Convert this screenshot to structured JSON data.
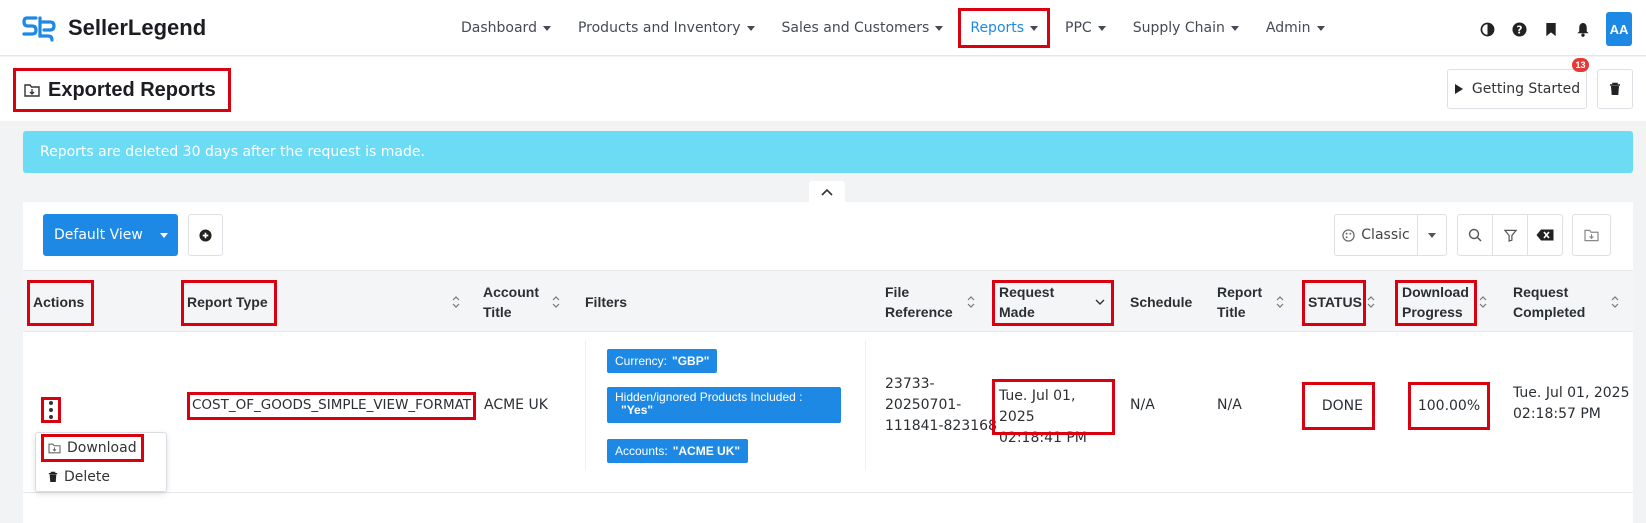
{
  "brand": {
    "name": "SellerLegend",
    "accent": "#1e88e5"
  },
  "nav": {
    "items": [
      {
        "label": "Dashboard"
      },
      {
        "label": "Products and Inventory"
      },
      {
        "label": "Sales and Customers"
      },
      {
        "label": "Reports"
      },
      {
        "label": "PPC"
      },
      {
        "label": "Supply Chain"
      },
      {
        "label": "Admin"
      }
    ],
    "icons": [
      "contrast-icon",
      "help-icon",
      "bookmark-icon",
      "bell-icon"
    ],
    "avatar": "AA"
  },
  "header": {
    "title": "Exported Reports",
    "getting_started_label": "Getting Started",
    "notification_count": "13"
  },
  "notice": {
    "text": "Reports are deleted 30 days after the request is made.",
    "color": "#6cdcf5"
  },
  "toolbar": {
    "view_label": "Default View",
    "layout_label": "Classic"
  },
  "table": {
    "columns": [
      {
        "key": "actions",
        "label": "Actions"
      },
      {
        "key": "report_type",
        "label": "Report Type"
      },
      {
        "key": "account_title",
        "label": "Account Title"
      },
      {
        "key": "filters",
        "label": "Filters"
      },
      {
        "key": "file_reference",
        "label": "File Reference"
      },
      {
        "key": "request_made",
        "label": "Request Made"
      },
      {
        "key": "schedule",
        "label": "Schedule"
      },
      {
        "key": "report_title",
        "label": "Report Title"
      },
      {
        "key": "status",
        "label": "STATUS"
      },
      {
        "key": "download_progress",
        "label": "Download Progress"
      },
      {
        "key": "request_completed",
        "label": "Request Completed"
      }
    ],
    "rows": [
      {
        "report_type": "COST_OF_GOODS_SIMPLE_VIEW_FORMAT",
        "account_title": "ACME UK",
        "filters": [
          {
            "name": "Currency:",
            "value": "\"GBP\""
          },
          {
            "name": "Hidden/ignored Products Included :",
            "value": "\"Yes\""
          },
          {
            "name": "Accounts:",
            "value": "\"ACME UK\""
          }
        ],
        "file_reference": "23733-20250701-111841-823168",
        "file_reference_lines": [
          "23733-",
          "20250701-",
          "111841-823168"
        ],
        "request_made": [
          "Tue. Jul 01, 2025",
          "02:18:41 PM"
        ],
        "schedule": "N/A",
        "report_title": "N/A",
        "status": "DONE",
        "download_progress": "100.00%",
        "request_completed": [
          "Tue. Jul 01, 2025",
          "02:18:57 PM"
        ]
      }
    ]
  },
  "row_actions": {
    "download_label": "Download",
    "delete_label": "Delete"
  }
}
